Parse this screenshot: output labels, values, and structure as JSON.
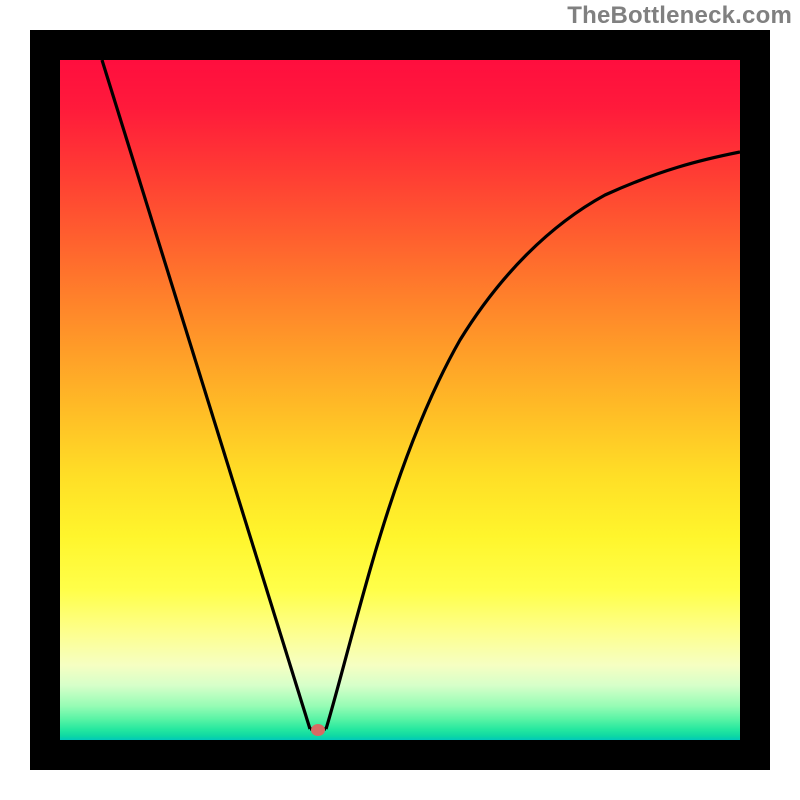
{
  "watermark": "TheBottleneck.com",
  "colors": {
    "frame": "#000000",
    "curve": "#000000",
    "marker": "#d76a63",
    "gradient_top": "#ff0e3e",
    "gradient_mid": "#ffde26",
    "gradient_bottom": "#00c9bb"
  },
  "chart_data": {
    "type": "line",
    "title": "",
    "xlabel": "",
    "ylabel": "",
    "xlim": [
      0,
      100
    ],
    "ylim": [
      0,
      100
    ],
    "series": [
      {
        "name": "bottleneck-curve",
        "x": [
          6,
          10,
          15,
          20,
          25,
          30,
          36.8,
          39.1,
          45,
          50,
          55,
          60,
          65,
          70,
          75,
          80,
          85,
          90,
          95,
          100
        ],
        "y_pct": [
          100,
          87,
          71,
          55,
          39,
          23,
          1.6,
          1.6,
          18,
          33,
          44,
          53,
          62,
          68,
          74,
          78,
          81,
          84,
          85,
          86.5
        ]
      }
    ],
    "optimum": {
      "x": 38.0,
      "y_pct": 1.5
    },
    "background": {
      "type": "vertical-gradient",
      "note": "green at bottom (low bottleneck) through yellow/orange to red at top (high bottleneck)"
    }
  }
}
